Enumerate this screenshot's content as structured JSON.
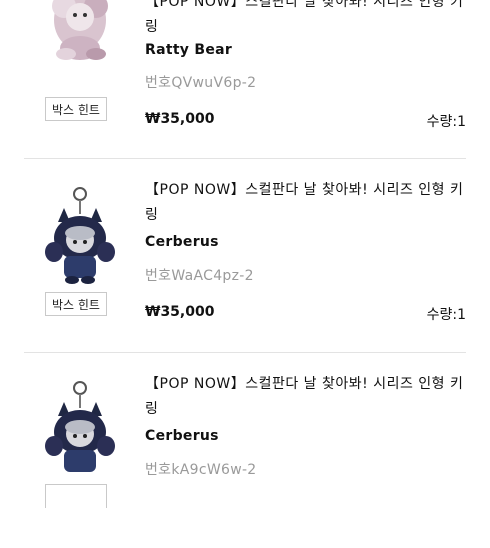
{
  "items": [
    {
      "title": "【POP NOW】스컬판다 날 찾아봐! 시리즈 인형 키링",
      "name": "Ratty Bear",
      "code": "번호QVwuV6p-2",
      "price": "₩35,000",
      "quantity": "수량:1",
      "hint_button": "박스 힌트",
      "thumb_icon": "ratty-bear-keyring-icon"
    },
    {
      "title": "【POP NOW】스컬판다 날 찾아봐! 시리즈 인형 키링",
      "name": "Cerberus",
      "code": "번호WaAC4pz-2",
      "price": "₩35,000",
      "quantity": "수량:1",
      "hint_button": "박스 힌트",
      "thumb_icon": "cerberus-keyring-icon"
    },
    {
      "title": "【POP NOW】스컬판다 날 찾아봐! 시리즈 인형 키링",
      "name": "Cerberus",
      "code": "번호kA9cW6w-2",
      "price": "",
      "quantity": "",
      "hint_button": "",
      "thumb_icon": "cerberus-keyring-icon"
    }
  ]
}
